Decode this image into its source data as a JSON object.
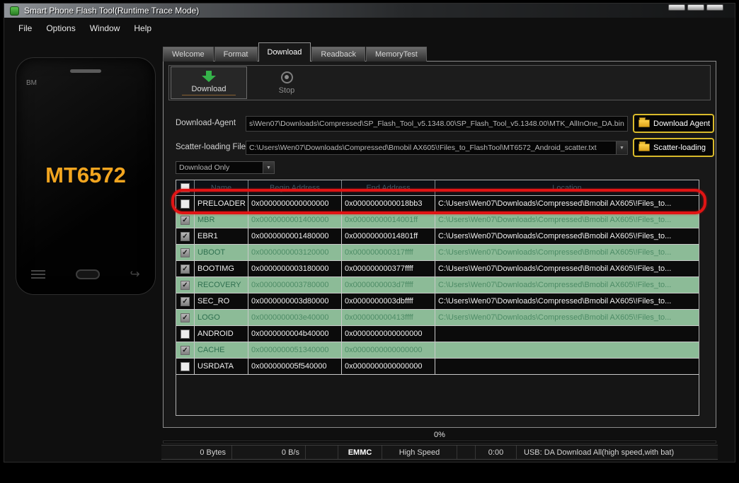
{
  "window": {
    "title": "Smart Phone Flash Tool(Runtime Trace Mode)",
    "menu": [
      "File",
      "Options",
      "Window",
      "Help"
    ]
  },
  "phone": {
    "brand": "BM",
    "model": "MT6572"
  },
  "tabs": [
    {
      "label": "Welcome",
      "active": false
    },
    {
      "label": "Format",
      "active": false
    },
    {
      "label": "Download",
      "active": true
    },
    {
      "label": "Readback",
      "active": false
    },
    {
      "label": "MemoryTest",
      "active": false
    }
  ],
  "toolbar": {
    "download": "Download",
    "stop": "Stop"
  },
  "fields": {
    "download_agent": {
      "label": "Download-Agent",
      "value": "s\\Wen07\\Downloads\\Compressed\\SP_Flash_Tool_v5.1348.00\\SP_Flash_Tool_v5.1348.00\\MTK_AllInOne_DA.bin",
      "button": "Download Agent"
    },
    "scatter": {
      "label": "Scatter-loading File",
      "value": "C:\\Users\\Wen07\\Downloads\\Compressed\\Bmobil AX605\\!Files_to_FlashTool\\MT6572_Android_scatter.txt",
      "button": "Scatter-loading"
    },
    "mode": {
      "value": "Download Only"
    }
  },
  "table": {
    "headers": [
      "Name",
      "Begin Address",
      "End Address",
      "Location"
    ],
    "rows": [
      {
        "name": "PRELOADER",
        "checked": false,
        "green": false,
        "highlighted": true,
        "begin": "0x0000000000000000",
        "end": "0x0000000000018bb3",
        "location": "C:\\Users\\Wen07\\Downloads\\Compressed\\Bmobil AX605\\!Files_to..."
      },
      {
        "name": "MBR",
        "checked": true,
        "green": true,
        "highlighted": false,
        "begin": "0x0000000001400000",
        "end": "0x00000000014001ff",
        "location": "C:\\Users\\Wen07\\Downloads\\Compressed\\Bmobil AX605\\!Files_to..."
      },
      {
        "name": "EBR1",
        "checked": true,
        "green": false,
        "highlighted": false,
        "begin": "0x0000000001480000",
        "end": "0x00000000014801ff",
        "location": "C:\\Users\\Wen07\\Downloads\\Compressed\\Bmobil AX605\\!Files_to..."
      },
      {
        "name": "UBOOT",
        "checked": true,
        "green": true,
        "highlighted": false,
        "begin": "0x0000000003120000",
        "end": "0x000000000317ffff",
        "location": "C:\\Users\\Wen07\\Downloads\\Compressed\\Bmobil AX605\\!Files_to..."
      },
      {
        "name": "BOOTIMG",
        "checked": true,
        "green": false,
        "highlighted": false,
        "begin": "0x0000000003180000",
        "end": "0x000000000377ffff",
        "location": "C:\\Users\\Wen07\\Downloads\\Compressed\\Bmobil AX605\\!Files_to..."
      },
      {
        "name": "RECOVERY",
        "checked": true,
        "green": true,
        "highlighted": false,
        "begin": "0x0000000003780000",
        "end": "0x0000000003d7ffff",
        "location": "C:\\Users\\Wen07\\Downloads\\Compressed\\Bmobil AX605\\!Files_to..."
      },
      {
        "name": "SEC_RO",
        "checked": true,
        "green": false,
        "highlighted": false,
        "begin": "0x0000000003d80000",
        "end": "0x0000000003dbffff",
        "location": "C:\\Users\\Wen07\\Downloads\\Compressed\\Bmobil AX605\\!Files_to..."
      },
      {
        "name": "LOGO",
        "checked": true,
        "green": true,
        "highlighted": false,
        "begin": "0x0000000003e40000",
        "end": "0x000000000413ffff",
        "location": "C:\\Users\\Wen07\\Downloads\\Compressed\\Bmobil AX605\\!Files_to..."
      },
      {
        "name": "ANDROID",
        "checked": false,
        "green": false,
        "highlighted": false,
        "begin": "0x0000000004b40000",
        "end": "0x0000000000000000",
        "location": ""
      },
      {
        "name": "CACHE",
        "checked": true,
        "green": true,
        "highlighted": false,
        "begin": "0x0000000051340000",
        "end": "0x0000000000000000",
        "location": ""
      },
      {
        "name": "USRDATA",
        "checked": false,
        "green": false,
        "highlighted": false,
        "begin": "0x000000005f540000",
        "end": "0x0000000000000000",
        "location": ""
      }
    ]
  },
  "progress": {
    "percent": "0%"
  },
  "statusbar": {
    "bytes": "0 Bytes",
    "rate": "0 B/s",
    "storage": "EMMC",
    "speed": "High Speed",
    "time": "0:00",
    "usb": "USB: DA Download All(high speed,with bat)"
  }
}
